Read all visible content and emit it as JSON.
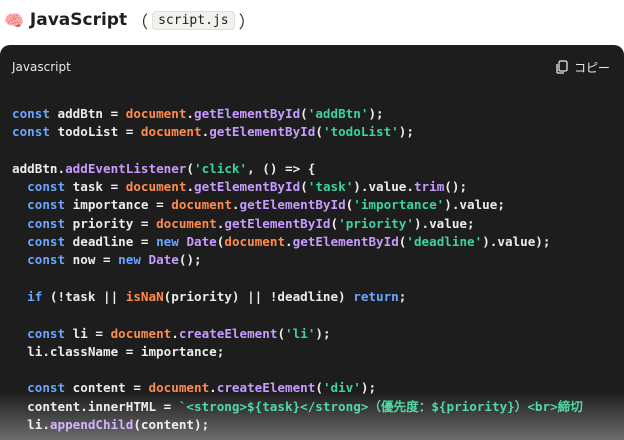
{
  "heading": {
    "emoji": "🧠",
    "title": "JavaScript",
    "open_paren": "（",
    "filename": "script.js",
    "close_paren": "）"
  },
  "code_block": {
    "language": "Javascript",
    "copy_label": "コピー",
    "copy_icon": "copy-icon",
    "lines": [
      [
        [
          "kw",
          "const"
        ],
        [
          "plain",
          " addBtn = "
        ],
        [
          "obj",
          "document"
        ],
        [
          "plain",
          "."
        ],
        [
          "fn",
          "getElementById"
        ],
        [
          "plain",
          "("
        ],
        [
          "str",
          "'addBtn'"
        ],
        [
          "plain",
          ");"
        ]
      ],
      [
        [
          "kw",
          "const"
        ],
        [
          "plain",
          " todoList = "
        ],
        [
          "obj",
          "document"
        ],
        [
          "plain",
          "."
        ],
        [
          "fn",
          "getElementById"
        ],
        [
          "plain",
          "("
        ],
        [
          "str",
          "'todoList'"
        ],
        [
          "plain",
          ");"
        ]
      ],
      [],
      [
        [
          "plain",
          "addBtn."
        ],
        [
          "fn",
          "addEventListener"
        ],
        [
          "plain",
          "("
        ],
        [
          "str",
          "'click'"
        ],
        [
          "plain",
          ", () => {"
        ]
      ],
      [
        [
          "plain",
          "  "
        ],
        [
          "kw",
          "const"
        ],
        [
          "plain",
          " task = "
        ],
        [
          "obj",
          "document"
        ],
        [
          "plain",
          "."
        ],
        [
          "fn",
          "getElementById"
        ],
        [
          "plain",
          "("
        ],
        [
          "str",
          "'task'"
        ],
        [
          "plain",
          ").value."
        ],
        [
          "fn",
          "trim"
        ],
        [
          "plain",
          "();"
        ]
      ],
      [
        [
          "plain",
          "  "
        ],
        [
          "kw",
          "const"
        ],
        [
          "plain",
          " importance = "
        ],
        [
          "obj",
          "document"
        ],
        [
          "plain",
          "."
        ],
        [
          "fn",
          "getElementById"
        ],
        [
          "plain",
          "("
        ],
        [
          "str",
          "'importance'"
        ],
        [
          "plain",
          ").value;"
        ]
      ],
      [
        [
          "plain",
          "  "
        ],
        [
          "kw",
          "const"
        ],
        [
          "plain",
          " priority = "
        ],
        [
          "obj",
          "document"
        ],
        [
          "plain",
          "."
        ],
        [
          "fn",
          "getElementById"
        ],
        [
          "plain",
          "("
        ],
        [
          "str",
          "'priority'"
        ],
        [
          "plain",
          ").value;"
        ]
      ],
      [
        [
          "plain",
          "  "
        ],
        [
          "kw",
          "const"
        ],
        [
          "plain",
          " deadline = "
        ],
        [
          "kw",
          "new"
        ],
        [
          "plain",
          " "
        ],
        [
          "fn",
          "Date"
        ],
        [
          "plain",
          "("
        ],
        [
          "obj",
          "document"
        ],
        [
          "plain",
          "."
        ],
        [
          "fn",
          "getElementById"
        ],
        [
          "plain",
          "("
        ],
        [
          "str",
          "'deadline'"
        ],
        [
          "plain",
          ").value);"
        ]
      ],
      [
        [
          "plain",
          "  "
        ],
        [
          "kw",
          "const"
        ],
        [
          "plain",
          " now = "
        ],
        [
          "kw",
          "new"
        ],
        [
          "plain",
          " "
        ],
        [
          "fn",
          "Date"
        ],
        [
          "plain",
          "();"
        ]
      ],
      [],
      [
        [
          "plain",
          "  "
        ],
        [
          "kw",
          "if"
        ],
        [
          "plain",
          " (!task || "
        ],
        [
          "obj",
          "isNaN"
        ],
        [
          "plain",
          "(priority) || !deadline) "
        ],
        [
          "kw",
          "return"
        ],
        [
          "plain",
          ";"
        ]
      ],
      [],
      [
        [
          "plain",
          "  "
        ],
        [
          "kw",
          "const"
        ],
        [
          "plain",
          " li = "
        ],
        [
          "obj",
          "document"
        ],
        [
          "plain",
          "."
        ],
        [
          "fn",
          "createElement"
        ],
        [
          "plain",
          "("
        ],
        [
          "str",
          "'li'"
        ],
        [
          "plain",
          ");"
        ]
      ],
      [
        [
          "plain",
          "  li.className = importance;"
        ]
      ],
      [],
      [
        [
          "plain",
          "  "
        ],
        [
          "kw",
          "const"
        ],
        [
          "plain",
          " content = "
        ],
        [
          "obj",
          "document"
        ],
        [
          "plain",
          "."
        ],
        [
          "fn",
          "createElement"
        ],
        [
          "plain",
          "("
        ],
        [
          "str",
          "'div'"
        ],
        [
          "plain",
          ");"
        ]
      ],
      [
        [
          "plain",
          "  content.innerHTML = "
        ],
        [
          "str",
          "`<strong>${task}</strong>（優先度：${priority}）<br>締切"
        ]
      ],
      [
        [
          "plain",
          "  li."
        ],
        [
          "fn",
          "appendChild"
        ],
        [
          "plain",
          "(content);"
        ]
      ]
    ]
  }
}
